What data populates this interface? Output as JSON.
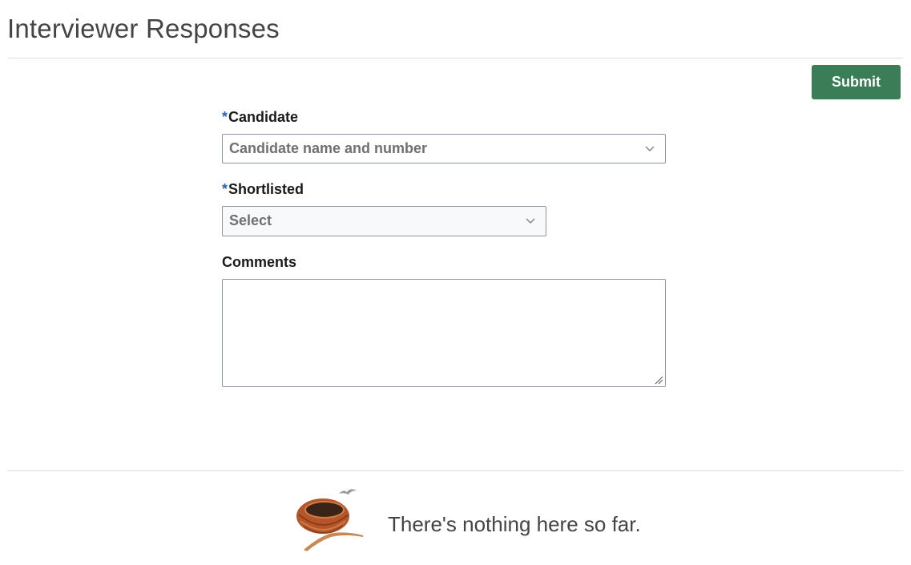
{
  "header": {
    "title": "Interviewer Responses"
  },
  "toolbar": {
    "submit_label": "Submit"
  },
  "form": {
    "candidate": {
      "required_marker": "*",
      "label": "Candidate",
      "placeholder": "Candidate name and number"
    },
    "shortlisted": {
      "required_marker": "*",
      "label": "Shortlisted",
      "placeholder": "Select"
    },
    "comments": {
      "label": "Comments",
      "value": ""
    }
  },
  "empty_state": {
    "icon": "empty-nest-icon",
    "message": "There's nothing here so far."
  },
  "colors": {
    "accent": "#3b7d56",
    "required": "#2a63b0",
    "border": "#8a96a3"
  }
}
